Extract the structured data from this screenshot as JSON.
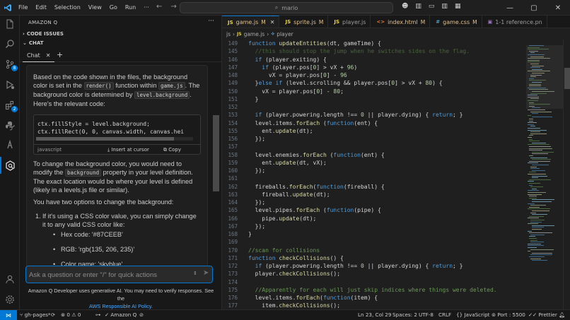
{
  "titlebar": {
    "menu": [
      "File",
      "Edit",
      "Selection",
      "View",
      "Go",
      "Run"
    ],
    "more": "···",
    "search": "mario"
  },
  "activity": {
    "source_control_badge": "8",
    "extensions_badge": "2"
  },
  "sidebar": {
    "title": "AMAZON Q",
    "sections": [
      {
        "label": "CODE ISSUES",
        "expanded": false
      },
      {
        "label": "CHAT",
        "expanded": true
      }
    ],
    "chat_tab": "Chat",
    "message": {
      "p1_a": "Based on the code shown in the files, the background color is set in the",
      "p1_code1": "render()",
      "p1_b": "function within",
      "p1_code2": "game.js",
      "p1_c": ". The background color is determined by",
      "p1_code3": "level.background",
      "p1_d": ". Here's the relevant code:",
      "code_lines": [
        "ctx.fillStyle = level.background;",
        "ctx.fillRect(0, 0, canvas.width, canvas.hei"
      ],
      "code_lang": "javascript",
      "insert_label": "Insert at cursor",
      "copy_label": "Copy",
      "p2_a": "To change the background color, you would need to modify the",
      "p2_code": "background",
      "p2_b": "property in your level definition. The exact location would be where your level is defined (likely in a levels.js file or similar).",
      "p3": "You have two options to change the background:",
      "list_num": "1.",
      "list_item": "If it's using a CSS color value, you can simply change it to any valid CSS color like:",
      "bullets": [
        "Hex code: '#87CEEB'",
        "RGB: 'rgb(135, 206, 235)'",
        "Color name: 'skyblue'"
      ]
    },
    "input_placeholder": "Ask a question or enter \"/\" for quick actions",
    "disclaimer": "Amazon Q Developer uses generative AI. You may need to verify responses. See the",
    "disclaimer_link": "AWS Responsible AI Policy."
  },
  "editor": {
    "tabs": [
      {
        "name": "game.js",
        "status": "M",
        "icon": "JS",
        "color": "#e2c08d",
        "active": true
      },
      {
        "name": "sprite.js",
        "status": "M",
        "icon": "JS",
        "color": "#e2c08d",
        "active": false
      },
      {
        "name": "player.js",
        "status": "",
        "icon": "JS",
        "color": "#9d9d9d",
        "active": false
      },
      {
        "name": "index.html",
        "status": "M",
        "icon": "<>",
        "color": "#e2c08d",
        "active": false
      },
      {
        "name": "game.css",
        "status": "M",
        "icon": "#",
        "color": "#e2c08d",
        "active": false
      },
      {
        "name": "1-1 reference.pn",
        "status": "",
        "icon": "▣",
        "color": "#9d9d9d",
        "active": false
      }
    ],
    "breadcrumb": [
      "js",
      "game.js",
      "player"
    ],
    "lines": [
      {
        "n": 149,
        "t": [
          [
            "k",
            "function "
          ],
          [
            "f",
            "updateEntities"
          ],
          [
            "p",
            "(dt, gameTime) {"
          ]
        ]
      },
      {
        "n": 145,
        "t": [
          [
            "c",
            "  //this should stop the jump when he switches sides on the flag."
          ]
        ]
      },
      {
        "n": 146,
        "t": [
          [
            "p",
            "  "
          ],
          [
            "k",
            "if"
          ],
          [
            "p",
            " (player.exiting) {"
          ]
        ]
      },
      {
        "n": 147,
        "t": [
          [
            "p",
            "    "
          ],
          [
            "k",
            "if"
          ],
          [
            "p",
            " (player.pos["
          ],
          [
            "n",
            "0"
          ],
          [
            "p",
            "] > vX + "
          ],
          [
            "n",
            "96"
          ],
          [
            "p",
            ")"
          ]
        ]
      },
      {
        "n": 148,
        "t": [
          [
            "p",
            "      vX = player.pos["
          ],
          [
            "n",
            "0"
          ],
          [
            "p",
            "] - "
          ],
          [
            "n",
            "96"
          ]
        ]
      },
      {
        "n": 149,
        "t": [
          [
            "p",
            "  }"
          ],
          [
            "k",
            "else if"
          ],
          [
            "p",
            " (level.scrolling && player.pos["
          ],
          [
            "n",
            "0"
          ],
          [
            "p",
            "] > vX + "
          ],
          [
            "n",
            "80"
          ],
          [
            "p",
            ") {"
          ]
        ]
      },
      {
        "n": 150,
        "t": [
          [
            "p",
            "    vX = player.pos["
          ],
          [
            "n",
            "0"
          ],
          [
            "p",
            "] - "
          ],
          [
            "n",
            "80"
          ],
          [
            "p",
            ";"
          ]
        ]
      },
      {
        "n": 151,
        "t": [
          [
            "p",
            "  }"
          ]
        ]
      },
      {
        "n": 152,
        "t": [
          [
            "p",
            ""
          ]
        ]
      },
      {
        "n": 153,
        "t": [
          [
            "p",
            "  "
          ],
          [
            "k",
            "if"
          ],
          [
            "p",
            " (player.powering.length !== "
          ],
          [
            "n",
            "0"
          ],
          [
            "p",
            " || player.dying) { "
          ],
          [
            "k",
            "return"
          ],
          [
            "p",
            "; }"
          ]
        ]
      },
      {
        "n": 154,
        "t": [
          [
            "p",
            "  level.items."
          ],
          [
            "f",
            "forEach"
          ],
          [
            "p",
            " ("
          ],
          [
            "k",
            "function"
          ],
          [
            "p",
            "(ent) {"
          ]
        ]
      },
      {
        "n": 155,
        "t": [
          [
            "p",
            "    ent."
          ],
          [
            "f",
            "update"
          ],
          [
            "p",
            "(dt);"
          ]
        ]
      },
      {
        "n": 156,
        "t": [
          [
            "p",
            "  });"
          ]
        ]
      },
      {
        "n": 157,
        "t": [
          [
            "p",
            ""
          ]
        ]
      },
      {
        "n": 158,
        "t": [
          [
            "p",
            "  level.enemies."
          ],
          [
            "f",
            "forEach"
          ],
          [
            "p",
            " ("
          ],
          [
            "k",
            "function"
          ],
          [
            "p",
            "(ent) {"
          ]
        ]
      },
      {
        "n": 159,
        "t": [
          [
            "p",
            "    ent."
          ],
          [
            "f",
            "update"
          ],
          [
            "p",
            "(dt, vX);"
          ]
        ]
      },
      {
        "n": 160,
        "t": [
          [
            "p",
            "  });"
          ]
        ]
      },
      {
        "n": 161,
        "t": [
          [
            "p",
            ""
          ]
        ]
      },
      {
        "n": 162,
        "t": [
          [
            "p",
            "  fireballs."
          ],
          [
            "f",
            "forEach"
          ],
          [
            "p",
            "("
          ],
          [
            "k",
            "function"
          ],
          [
            "p",
            "(fireball) {"
          ]
        ]
      },
      {
        "n": 163,
        "t": [
          [
            "p",
            "    fireball."
          ],
          [
            "f",
            "update"
          ],
          [
            "p",
            "(dt);"
          ]
        ]
      },
      {
        "n": 164,
        "t": [
          [
            "p",
            "  });"
          ]
        ]
      },
      {
        "n": 165,
        "t": [
          [
            "p",
            "  level.pipes."
          ],
          [
            "f",
            "forEach"
          ],
          [
            "p",
            " ("
          ],
          [
            "k",
            "function"
          ],
          [
            "p",
            "(pipe) {"
          ]
        ]
      },
      {
        "n": 166,
        "t": [
          [
            "p",
            "    pipe."
          ],
          [
            "f",
            "update"
          ],
          [
            "p",
            "(dt);"
          ]
        ]
      },
      {
        "n": 167,
        "t": [
          [
            "p",
            "  });"
          ]
        ]
      },
      {
        "n": 168,
        "t": [
          [
            "p",
            "}"
          ]
        ]
      },
      {
        "n": 169,
        "t": [
          [
            "p",
            ""
          ]
        ]
      },
      {
        "n": 170,
        "t": [
          [
            "c",
            "//scan for collisions"
          ]
        ]
      },
      {
        "n": 171,
        "t": [
          [
            "k",
            "function "
          ],
          [
            "f",
            "checkCollisions"
          ],
          [
            "p",
            "() {"
          ]
        ]
      },
      {
        "n": 172,
        "t": [
          [
            "p",
            "  "
          ],
          [
            "k",
            "if"
          ],
          [
            "p",
            " (player.powering.length !== "
          ],
          [
            "n",
            "0"
          ],
          [
            "p",
            " || player.dying) { "
          ],
          [
            "k",
            "return"
          ],
          [
            "p",
            "; }"
          ]
        ]
      },
      {
        "n": 173,
        "t": [
          [
            "p",
            "  player."
          ],
          [
            "f",
            "checkCollisions"
          ],
          [
            "p",
            "();"
          ]
        ]
      },
      {
        "n": 174,
        "t": [
          [
            "p",
            ""
          ]
        ]
      },
      {
        "n": 175,
        "t": [
          [
            "c",
            "  //Apparently for each will just skip indices where things were deleted."
          ]
        ]
      },
      {
        "n": 176,
        "t": [
          [
            "p",
            "  level.items."
          ],
          [
            "f",
            "forEach"
          ],
          [
            "p",
            "("
          ],
          [
            "k",
            "function"
          ],
          [
            "p",
            "(item) {"
          ]
        ]
      },
      {
        "n": 177,
        "t": [
          [
            "p",
            "    item."
          ],
          [
            "f",
            "checkCollisions"
          ],
          [
            "p",
            "();"
          ]
        ]
      },
      {
        "n": 178,
        "t": [
          [
            "p",
            "  });"
          ]
        ]
      }
    ]
  },
  "statusbar": {
    "branch": "gh-pages*",
    "errors": "0",
    "warnings": "0",
    "extension": "Amazon Q",
    "cursor": "Ln 23, Col 29",
    "spaces": "Spaces: 2",
    "encoding": "UTF-8",
    "eol": "CRLF",
    "language": "JavaScript",
    "port": "Port : 5500",
    "formatter": "Prettier"
  },
  "colors": {
    "accent": "#0078d4",
    "keyword": "#569cd6",
    "function": "#dcdcaa",
    "number": "#b5cea8",
    "comment": "#6a9955",
    "modified": "#e2c08d"
  }
}
